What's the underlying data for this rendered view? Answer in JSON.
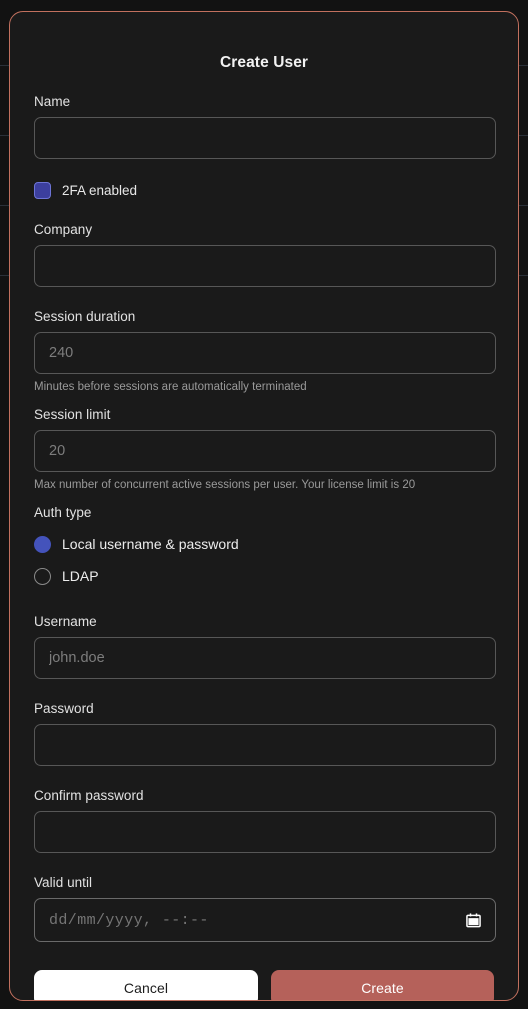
{
  "theme": {
    "page_background": "#121212",
    "modal_background": "#1a1a1a",
    "modal_border": "#c2705e",
    "accent_indigo": "#4453bb",
    "accent_terracotta": "#b5615a",
    "text_primary": "#f0f0f0",
    "text_muted": "#9a9a9a",
    "input_border": "#575757"
  },
  "backdrop": {
    "row_line_offsets": [
      65,
      135,
      205,
      275
    ]
  },
  "modal": {
    "title": "Create User",
    "fields": {
      "name": {
        "label": "Name",
        "value": "",
        "placeholder": ""
      },
      "twofa": {
        "label": "2FA enabled",
        "checked": true
      },
      "company": {
        "label": "Company",
        "value": "",
        "placeholder": ""
      },
      "session_duration": {
        "label": "Session duration",
        "value": "",
        "placeholder": "240",
        "hint": "Minutes before sessions are automatically terminated"
      },
      "session_limit": {
        "label": "Session limit",
        "value": "",
        "placeholder": "20",
        "hint": "Max number of concurrent active sessions per user. Your license limit is 20"
      },
      "auth_type": {
        "label": "Auth type",
        "selected": "Local username & password",
        "options": [
          {
            "label": "Local username & password",
            "selected": true
          },
          {
            "label": "LDAP",
            "selected": false
          }
        ]
      },
      "username": {
        "label": "Username",
        "value": "",
        "placeholder": "john.doe"
      },
      "password": {
        "label": "Password",
        "value": "",
        "placeholder": ""
      },
      "confirm_password": {
        "label": "Confirm password",
        "value": "",
        "placeholder": ""
      },
      "valid_until": {
        "label": "Valid until",
        "value": "",
        "placeholder": "dd/mm/yyyy, --:--",
        "icon": "calendar-icon"
      }
    },
    "actions": {
      "cancel_label": "Cancel",
      "create_label": "Create"
    }
  }
}
